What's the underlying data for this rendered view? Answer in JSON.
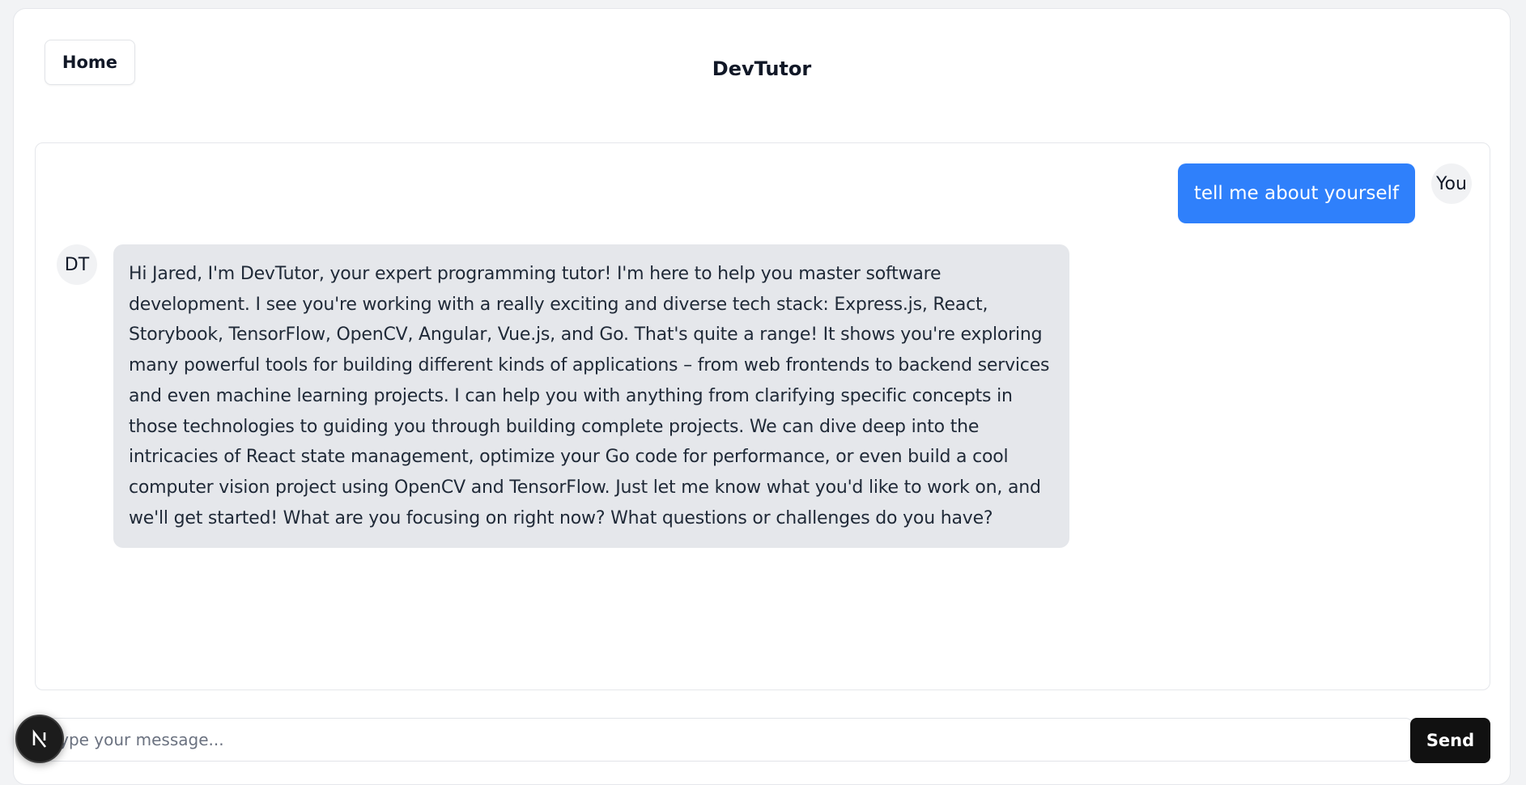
{
  "header": {
    "home_label": "Home",
    "title": "DevTutor"
  },
  "chat": {
    "messages": [
      {
        "role": "user",
        "avatar": "You",
        "text": "tell me about yourself"
      },
      {
        "role": "assistant",
        "avatar": "DT",
        "text": "Hi Jared, I'm DevTutor, your expert programming tutor! I'm here to help you master software development. I see you're working with a really exciting and diverse tech stack: Express.js, React, Storybook, TensorFlow, OpenCV, Angular, Vue.js, and Go. That's quite a range! It shows you're exploring many powerful tools for building different kinds of applications – from web frontends to backend services and even machine learning projects. I can help you with anything from clarifying specific concepts in those technologies to guiding you through building complete projects. We can dive deep into the intricacies of React state management, optimize your Go code for performance, or even build a cool computer vision project using OpenCV and TensorFlow. Just let me know what you'd like to work on, and we'll get started! What are you focusing on right now? What questions or challenges do you have?"
      }
    ]
  },
  "composer": {
    "placeholder": "Type your message...",
    "value": "",
    "send_label": "Send"
  },
  "dev_badge": {
    "icon": "nextjs-n-icon"
  },
  "colors": {
    "user_bubble": "#2f80fb",
    "assistant_bubble": "#e5e7eb",
    "send_button": "#111111",
    "page_background": "#f2f3f5"
  }
}
